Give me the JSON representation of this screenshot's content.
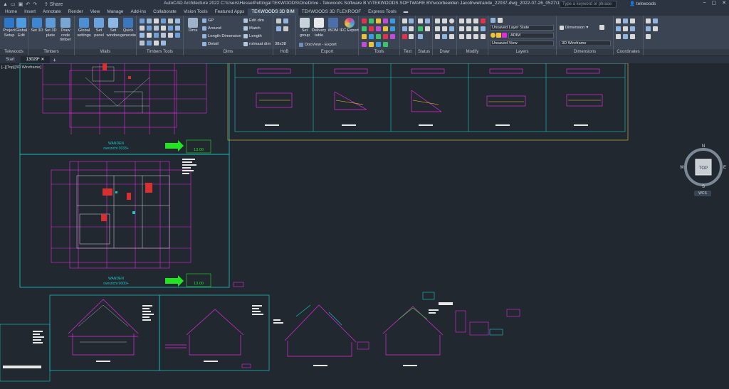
{
  "titlebar": {
    "share_label": "Share",
    "title": "AutoCAD Architecture 2022    C:\\Users\\HesselPettinga\\TEKWOODS\\OneDrive - Tekwoods Software B.V\\TEKWOODS SOFTWARE BV\\voorbeelden Jacob\\wetrande_22037-dwg_2022-07-26_0527\\13029.dwg",
    "search_placeholder": "Type a keyword or phrase",
    "user_name": "tekwoods"
  },
  "ribbon_tabs": [
    "Home",
    "Insert",
    "Annotate",
    "Render",
    "View",
    "Manage",
    "Add-ins",
    "Collaborate",
    "Vision Tools",
    "Featured Apps",
    "TEKWOODS 3D BIM",
    "TEKWOODS 3D FLEXROOF",
    "Express Tools"
  ],
  "active_tab": "TEKWOODS 3D BIM",
  "panels": {
    "tekwoods": {
      "title": "Tekwoods",
      "tools": [
        {
          "label": "Project\nSetup"
        },
        {
          "label": "Global\nEdit"
        }
      ]
    },
    "timbers": {
      "title": "Timbers",
      "tools": [
        {
          "label": "Set 3D"
        },
        {
          "label": "Set 3D\nplate"
        },
        {
          "label": "Draw code\ntimber"
        }
      ]
    },
    "walls": {
      "title": "Walls",
      "tools": [
        {
          "label": "Global\nsettings"
        },
        {
          "label": "Set\npanel"
        },
        {
          "label": "Set\nwindow"
        },
        {
          "label": "Quick\ngenerate"
        }
      ]
    },
    "timbers_tools": {
      "title": "Timbers Tools"
    },
    "dims": {
      "title": "Dims",
      "big_label": "Dims",
      "rows": [
        "GP",
        "Around",
        "Length Dimension",
        "Detail"
      ]
    },
    "edit": {
      "rows": [
        "Edit dim",
        "Match",
        "Length",
        "rolmaat dim"
      ]
    },
    "hob": {
      "title": "HoB",
      "label": "38x38"
    },
    "export": {
      "title": "Export",
      "tools": [
        {
          "label": "Set\ngroup"
        },
        {
          "label": "Delivery\ntable"
        },
        {
          "label": "iBOM"
        },
        {
          "label": "IFC Export"
        }
      ],
      "docview": "DocView - Export"
    },
    "tools_panel": {
      "title": "Tools"
    },
    "text_panel": {
      "title": "Text"
    },
    "status_panel": {
      "title": "Status"
    },
    "draw_panel": {
      "title": "Draw"
    },
    "modify_panel": {
      "title": "Modify"
    },
    "layers": {
      "title": "Layers",
      "layer_state": "Unsaved Layer State",
      "current_layer": "ADIM",
      "view": "Unsaved View"
    },
    "dimensions": {
      "title": "Dimensions",
      "dimension_label": "Dimension",
      "visual_style": "3D Wireframe"
    },
    "coordinates": {
      "title": "Coordinates"
    }
  },
  "file_tabs": {
    "start": "Start",
    "current": "13029*"
  },
  "viewport": {
    "controls": "[–][Top][3D Wireframe]",
    "viewcube": {
      "top": "TOP",
      "north": "N",
      "south": "S",
      "east": "E",
      "west": "W"
    },
    "wcs": "WCS"
  },
  "drawing": {
    "sheet1_title": "WANDEN",
    "sheet1_subtitle": "overzicht 3033+",
    "sheet1_code": "13.00",
    "sheet2_title": "WANDEN",
    "sheet2_subtitle": "overzicht 0000+",
    "sheet2_code": "13.00"
  },
  "colors": {
    "ribbon_bg": "#3b4452",
    "canvas_bg": "#212830",
    "magenta": "#e22bdc",
    "cyan": "#19c6c6",
    "green_arrow": "#22e522",
    "gold_frame": "#b59a3a"
  }
}
